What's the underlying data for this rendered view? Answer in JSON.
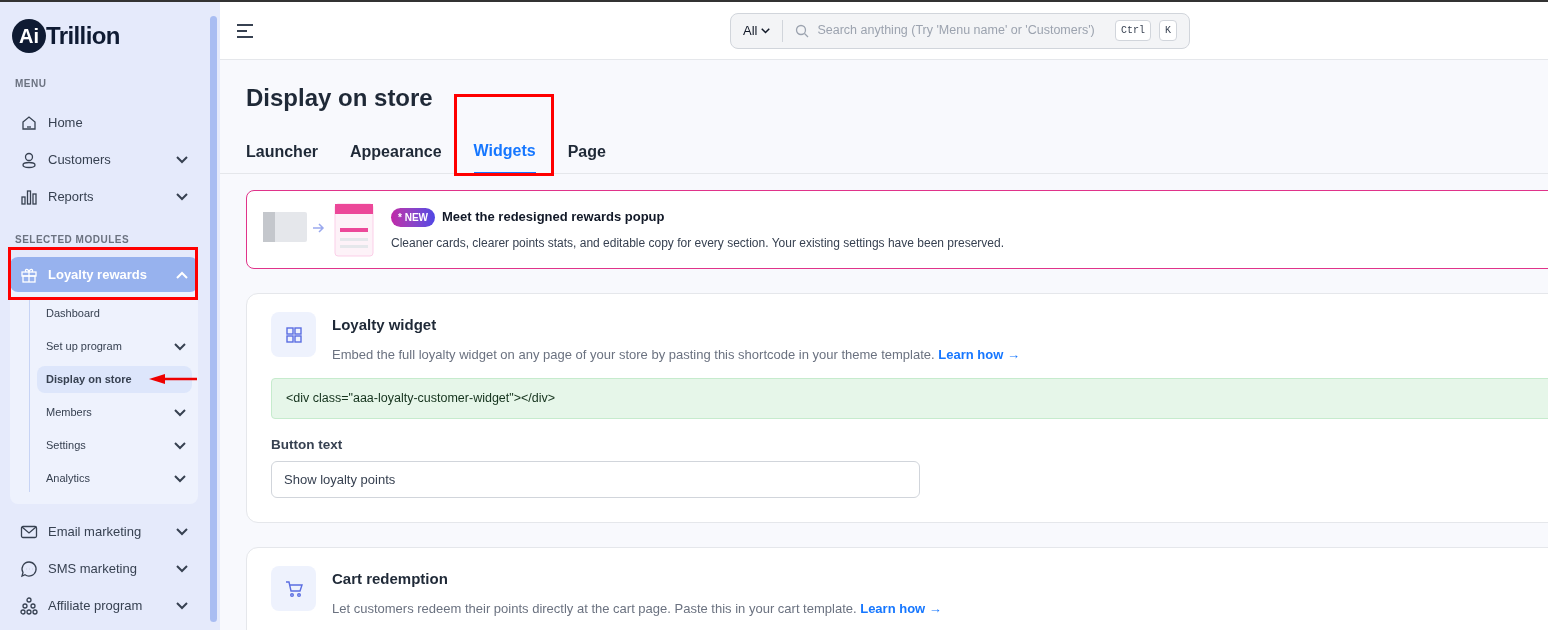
{
  "logo": {
    "badge": "Ai",
    "text": "Trillion"
  },
  "sidebar": {
    "sections": [
      {
        "heading": "MENU",
        "items": [
          {
            "label": "Home",
            "kind": "home",
            "expandable": false,
            "expanded": false,
            "highlighted": false
          },
          {
            "label": "Customers",
            "kind": "user",
            "expandable": true,
            "expanded": false,
            "highlighted": false
          },
          {
            "label": "Reports",
            "kind": "chart",
            "expandable": true,
            "expanded": false,
            "highlighted": false
          }
        ]
      },
      {
        "heading": "SELECTED MODULES",
        "items": [
          {
            "label": "Loyalty rewards",
            "kind": "gift",
            "expandable": true,
            "expanded": true,
            "highlighted": true,
            "children": [
              {
                "label": "Dashboard",
                "expandable": false,
                "selected": false,
                "pointed": false
              },
              {
                "label": "Set up program",
                "expandable": true,
                "selected": false,
                "pointed": false
              },
              {
                "label": "Display on store",
                "expandable": false,
                "selected": true,
                "pointed": true
              },
              {
                "label": "Members",
                "expandable": true,
                "selected": false,
                "pointed": false
              },
              {
                "label": "Settings",
                "expandable": true,
                "selected": false,
                "pointed": false
              },
              {
                "label": "Analytics",
                "expandable": true,
                "selected": false,
                "pointed": false
              }
            ]
          },
          {
            "label": "Email marketing",
            "kind": "mail",
            "expandable": true,
            "expanded": false,
            "highlighted": false
          },
          {
            "label": "SMS marketing",
            "kind": "chat",
            "expandable": true,
            "expanded": false,
            "highlighted": false
          },
          {
            "label": "Affiliate program",
            "kind": "network",
            "expandable": true,
            "expanded": false,
            "highlighted": false
          }
        ]
      }
    ]
  },
  "search": {
    "scope": "All",
    "placeholder": "Search anything (Try 'Menu name' or 'Customers')",
    "keys": [
      "Ctrl",
      "K"
    ]
  },
  "page_title": "Display on store",
  "tabs": [
    {
      "label": "Launcher",
      "selected": false,
      "highlighted": false
    },
    {
      "label": "Appearance",
      "selected": false,
      "highlighted": false
    },
    {
      "label": "Widgets",
      "selected": true,
      "highlighted": true
    },
    {
      "label": "Page",
      "selected": false,
      "highlighted": false
    }
  ],
  "banner": {
    "badge": "* NEW",
    "title": "Meet the redesigned rewards popup",
    "text": "Cleaner cards, clearer points stats, and editable copy for every section. Your existing settings have been preserved."
  },
  "cards": [
    {
      "kind": "grid",
      "title": "Loyalty widget",
      "text": "Embed the full loyalty widget on any page of your store by pasting this shortcode in your theme template.",
      "link": "Learn how →",
      "code": "<div class=\"aaa-loyalty-customer-widget\"></div>",
      "field_label": "Button text",
      "field_value": "Show loyalty points"
    },
    {
      "kind": "cart",
      "title": "Cart redemption",
      "text": "Let customers redeem their points directly at the cart page. Paste this in your cart template.",
      "link": "Learn how →"
    }
  ]
}
